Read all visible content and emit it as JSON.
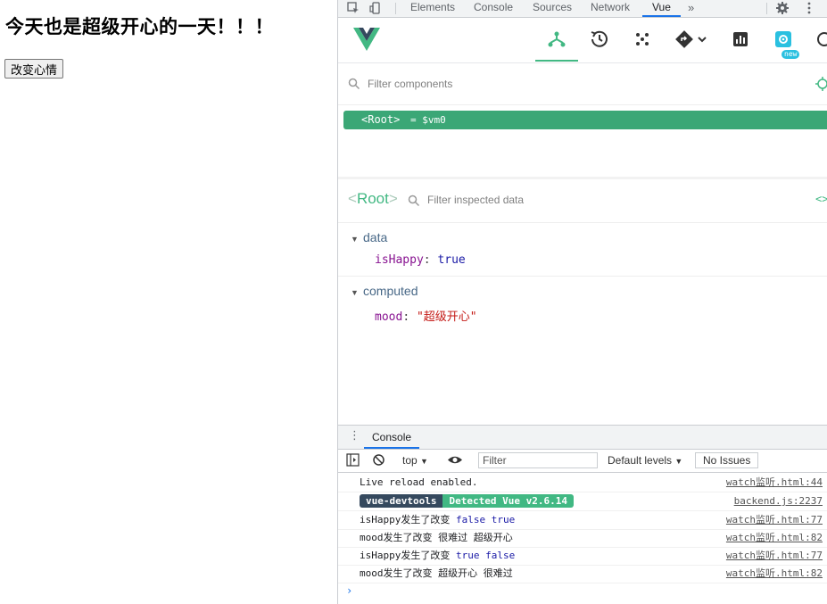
{
  "page": {
    "heading": "今天也是超级开心的一天！！！",
    "button_label": "改变心情"
  },
  "devtools": {
    "tabs": [
      "Elements",
      "Console",
      "Sources",
      "Network",
      "Vue"
    ],
    "active_tab": "Vue",
    "more_tabs": "»",
    "vue": {
      "new_badge": "new",
      "filter_components_placeholder": "Filter components",
      "tree": {
        "root_tag": "<Root>",
        "vm_ref": "= $vm0"
      },
      "inspector": {
        "component_name": "Root",
        "bracket_open": "<",
        "bracket_close": ">",
        "filter_placeholder": "Filter inspected data",
        "sections": [
          {
            "title": "data",
            "key": "isHappy",
            "value": "true",
            "value_type": "bool"
          },
          {
            "title": "computed",
            "key": "mood",
            "value": "\"超级开心\"",
            "value_type": "string"
          }
        ]
      }
    },
    "drawer": {
      "tab": "Console",
      "toolbar": {
        "context": "top",
        "filter_placeholder": "Filter",
        "levels": "Default levels",
        "issues": "No Issues"
      },
      "logs": [
        {
          "text": "Live reload enabled.",
          "source": "watch监听.html:44"
        },
        {
          "badge_a": "vue-devtools",
          "badge_b": "Detected Vue v2.6.14",
          "source": "backend.js:2237"
        },
        {
          "label": "isHappy发生了改变",
          "v1": "false",
          "v2": "true",
          "source": "watch监听.html:77"
        },
        {
          "text": "mood发生了改变 很难过 超级开心",
          "source": "watch监听.html:82"
        },
        {
          "label": "isHappy发生了改变",
          "v1": "true",
          "v2": "false",
          "source": "watch监听.html:77"
        },
        {
          "text": "mood发生了改变 超级开心 很难过",
          "source": "watch监听.html:82"
        }
      ],
      "prompt": "›"
    }
  },
  "colors": {
    "vue_green": "#42b883",
    "tree_highlight": "#3ba776",
    "devtools_accent": "#1a73e8",
    "badge_dark": "#35495e"
  }
}
